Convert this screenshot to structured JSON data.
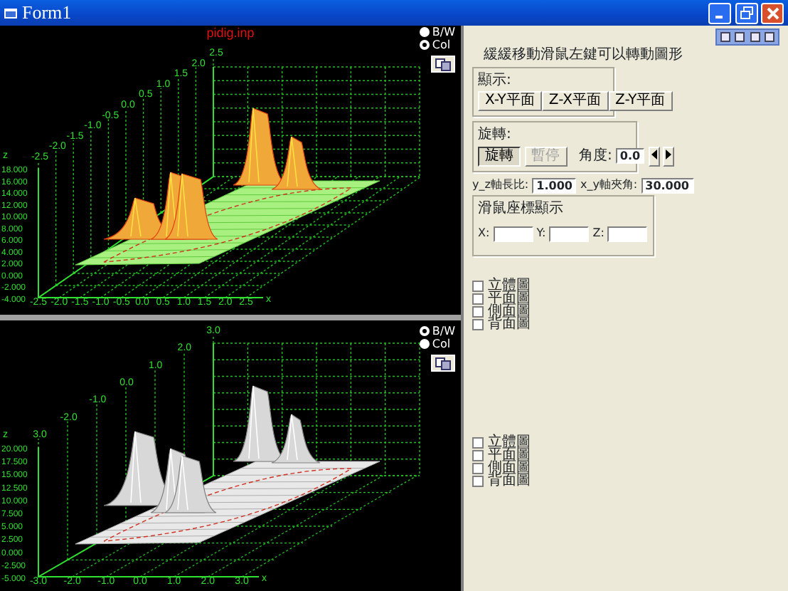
{
  "window": {
    "title": "Form1"
  },
  "plots": [
    {
      "title": "pidig.inp",
      "z_axis_label": "z",
      "z_ticks": [
        "18.000",
        "16.000",
        "14.000",
        "12.000",
        "10.000",
        "8.000",
        "6.000",
        "4.000",
        "2.000",
        "0.000",
        "-2.000",
        "-4.000"
      ],
      "y_ticks": [
        "2.5",
        "2.0",
        "1.5",
        "1.0",
        "0.5",
        "0.0",
        "-0.5",
        "-1.0",
        "-1.5",
        "-2.0",
        "-2.5"
      ],
      "x_ticks": [
        "-2.5",
        "-2.0",
        "-1.5",
        "-1.0",
        "-0.5",
        "0.0",
        "0.5",
        "1.0",
        "1.5",
        "2.0",
        "2.5"
      ],
      "x_axis_label": "x",
      "modes": [
        {
          "label": "B/W",
          "selected": false
        },
        {
          "label": "Col",
          "selected": true
        }
      ],
      "views": [
        {
          "label": "立體圖",
          "checked": false
        },
        {
          "label": "平面圖",
          "checked": false
        },
        {
          "label": "側面圖",
          "checked": false
        },
        {
          "label": "背面圖",
          "checked": false
        }
      ]
    },
    {
      "z_axis_label": "z",
      "z_ticks": [
        "20.000",
        "17.500",
        "15.000",
        "12.500",
        "10.000",
        "7.500",
        "5.000",
        "2.500",
        "0.000",
        "-2.500",
        "-5.000"
      ],
      "y_ticks": [
        "3.0",
        "2.0",
        "1.0",
        "0.0",
        "-1.0",
        "-2.0",
        "3.0"
      ],
      "x_ticks": [
        "-3.0",
        "-2.0",
        "-1.0",
        "0.0",
        "1.0",
        "2.0",
        "3.0"
      ],
      "x_axis_label": "x",
      "modes": [
        {
          "label": "B/W",
          "selected": true
        },
        {
          "label": "Col",
          "selected": false
        }
      ],
      "views": [
        {
          "label": "立體圖",
          "checked": false
        },
        {
          "label": "平面圖",
          "checked": false
        },
        {
          "label": "側面圖",
          "checked": false
        },
        {
          "label": "背面圖",
          "checked": false
        }
      ]
    }
  ],
  "controls": {
    "hint": "緩緩移動滑鼠左鍵可以轉動圖形",
    "display": {
      "label": "顯示:",
      "buttons": [
        "X-Y平面",
        "Z-X平面",
        "Z-Y平面"
      ]
    },
    "rotate": {
      "label": "旋轉:",
      "buttons": [
        {
          "label": "旋轉",
          "pressed": true,
          "disabled": false
        },
        {
          "label": "暫停",
          "pressed": false,
          "disabled": true
        }
      ],
      "angle_label": "角度:",
      "angle_value": "0.0"
    },
    "ratio_label": "y_z軸長比:",
    "ratio_value": "1.000",
    "tilt_label": "x_y軸夾角:",
    "tilt_value": "30.000",
    "mouse": {
      "label": "滑鼠座標顯示",
      "fields": [
        "X:",
        "Y:",
        "Z:"
      ]
    }
  }
}
